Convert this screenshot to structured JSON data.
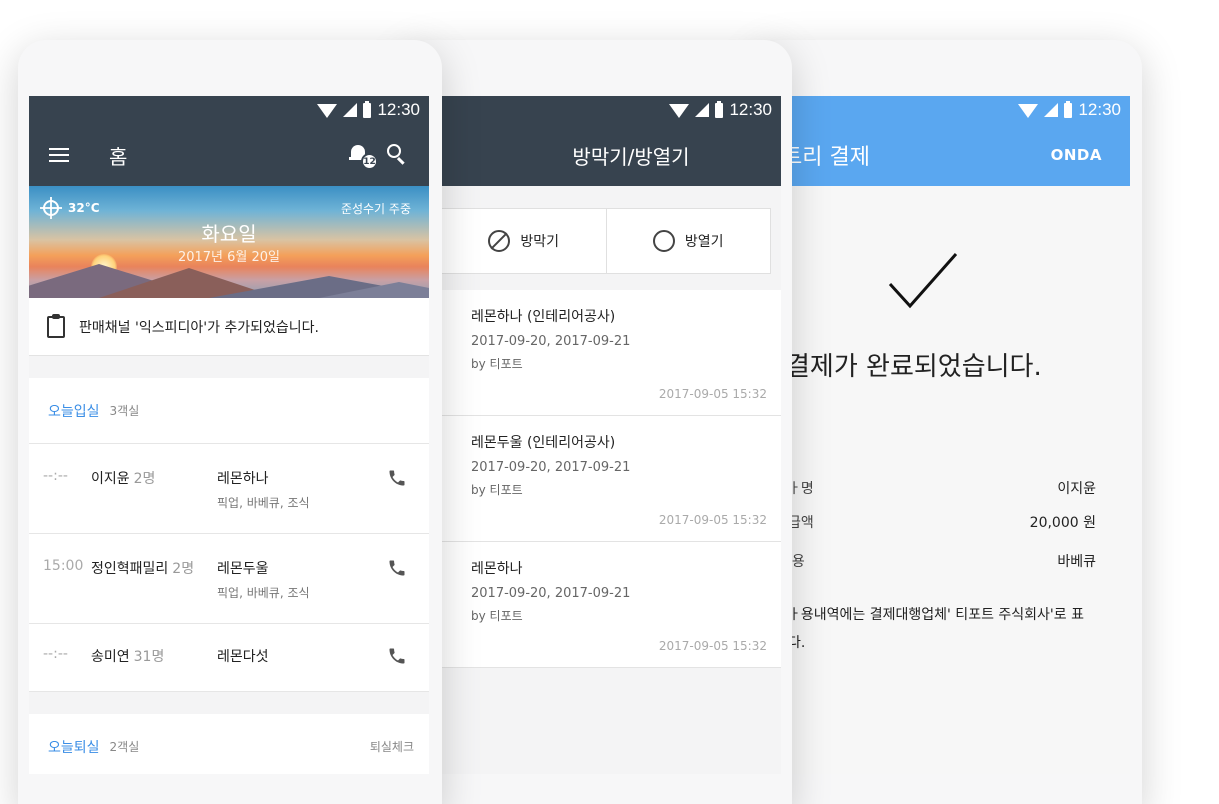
{
  "status_bar": {
    "time": "12:30"
  },
  "screen1": {
    "appbar": {
      "title": "홈",
      "notification_count": "12"
    },
    "weather": {
      "temperature": "32°C",
      "rule": "준성수기 주중",
      "weekday": "화요일",
      "date": "2017년 6월 20일"
    },
    "notice": "판매채널 '익스피디아'가 추가되었습니다.",
    "checkin": {
      "title": "오늘입실",
      "count": "3객실",
      "rows": [
        {
          "time": "--:--",
          "name": "이지윤",
          "guests": "2명",
          "room": "레몬하나",
          "options": "픽업, 바베큐, 조식"
        },
        {
          "time": "15:00",
          "name": "정인혁패밀리",
          "guests": "2명",
          "room": "레몬두울",
          "options": "픽업, 바베큐, 조식"
        },
        {
          "time": "--:--",
          "name": "송미연",
          "guests": "31명",
          "room": "레몬다섯",
          "options": ""
        }
      ]
    },
    "checkout": {
      "title": "오늘퇴실",
      "count": "2객실",
      "action": "퇴실체크"
    }
  },
  "screen2": {
    "appbar": {
      "title": "방막기/방열기"
    },
    "tabs": [
      {
        "label": "방막기",
        "icon": "block-icon"
      },
      {
        "label": "방열기",
        "icon": "radio-icon"
      }
    ],
    "cards": [
      {
        "title": "레몬하나 (인테리어공사)",
        "dates": "2017-09-20, 2017-09-21",
        "by": "by 티포트",
        "stamp": "2017-09-05 15:32"
      },
      {
        "title": "레몬두울 (인테리어공사)",
        "dates": "2017-09-20, 2017-09-21",
        "by": "by 티포트",
        "stamp": "2017-09-05 15:32"
      },
      {
        "title": "레몬하나",
        "dates": "2017-09-20, 2017-09-21",
        "by": "by 티포트",
        "stamp": "2017-09-05 15:32"
      }
    ]
  },
  "screen3": {
    "appbar": {
      "title": "트리 결제",
      "logo": "ONDA"
    },
    "message": "결제가 완료되었습니다.",
    "details": [
      {
        "key": "ㅏ명",
        "value": "이지윤"
      },
      {
        "key": "급액",
        "value": "20,000 원"
      },
      {
        "key": "l용",
        "value": "바베큐"
      }
    ],
    "note_line1": "ㅏ용내역에는 결제대행업체' 티포트 주식회사'로 표",
    "note_line2": "다."
  },
  "colors": {
    "dark_header": "#37434f",
    "blue_header": "#5aa7f0",
    "accent": "#3a8ee6"
  }
}
